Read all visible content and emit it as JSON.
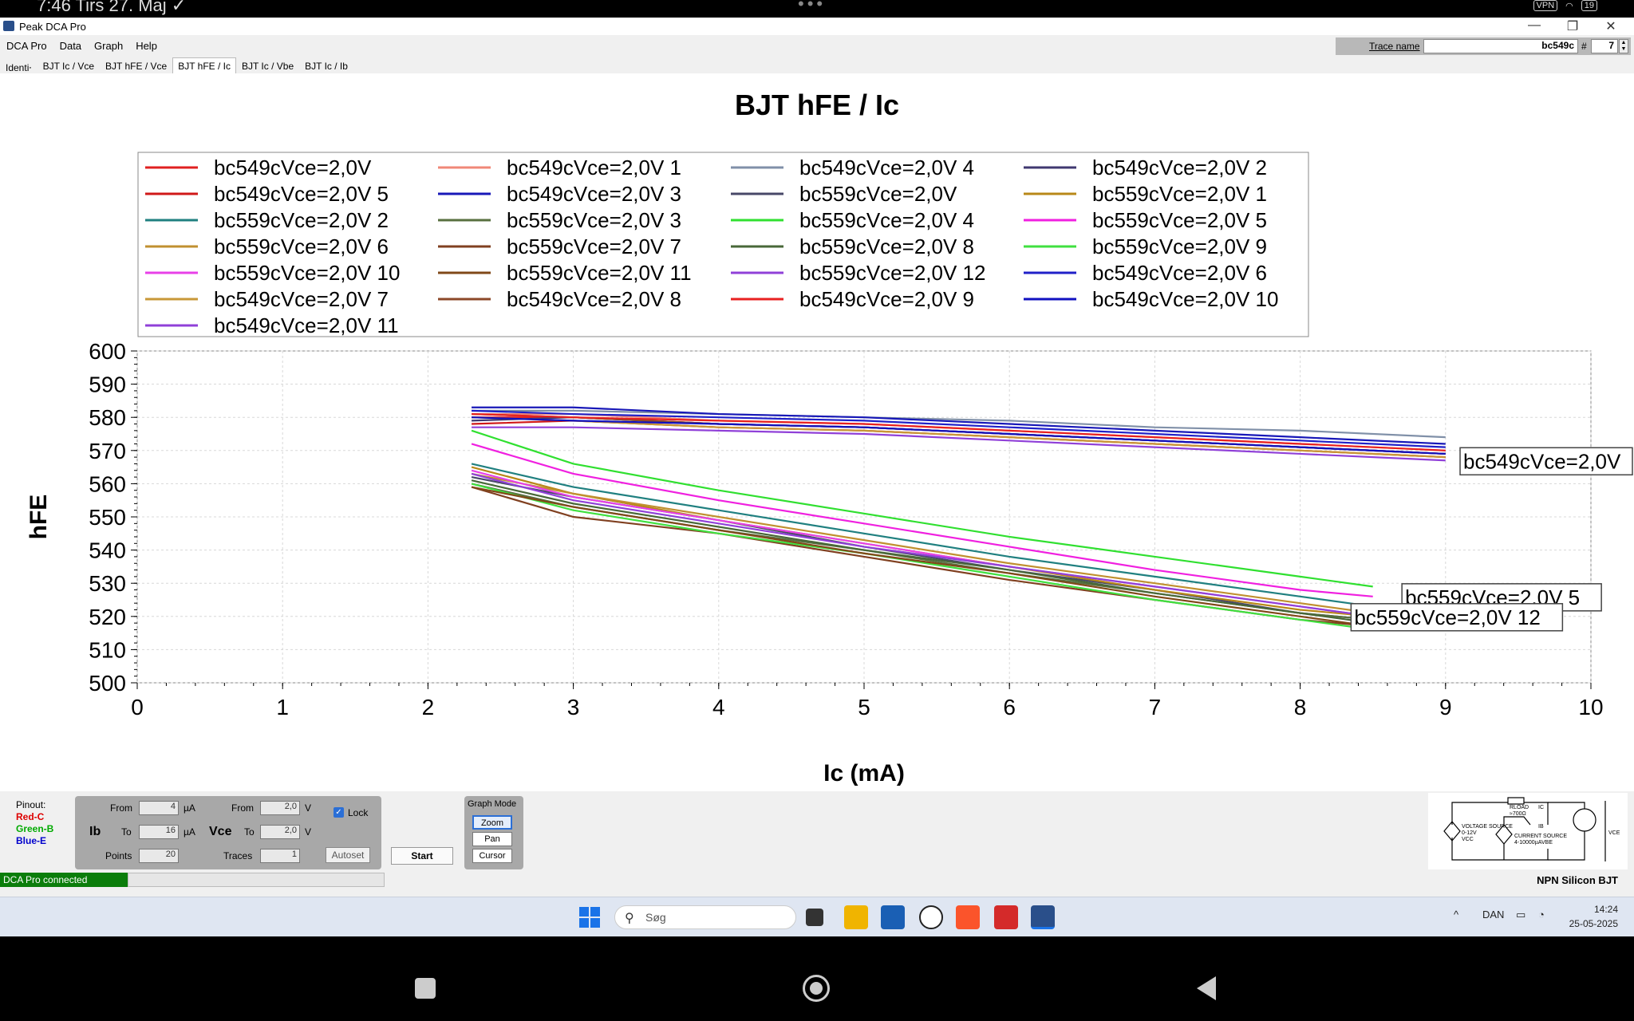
{
  "android": {
    "time": "7:46",
    "date": "Tirs 27. Maj",
    "vpn": "VPN",
    "battery": "19"
  },
  "window": {
    "title": "Peak DCA Pro",
    "minimize": "—",
    "maximize": "❐",
    "close": "✕"
  },
  "menu": [
    "DCA Pro",
    "Data",
    "Graph",
    "Help"
  ],
  "trace": {
    "label": "Trace name",
    "name_value": "bc549c",
    "hash": "#",
    "number_value": "7"
  },
  "tabs": [
    "Identi⸱",
    "BJT Ic / Vce",
    "BJT hFE / Vce",
    "BJT hFE / Ic",
    "BJT Ic / Vbe",
    "BJT Ic / Ib"
  ],
  "active_tab": 3,
  "chart_data": {
    "type": "line",
    "title": "BJT hFE / Ic",
    "xlabel": "Ic (mA)",
    "ylabel": "hFE",
    "xlim": [
      0,
      10
    ],
    "ylim": [
      500,
      600
    ],
    "xticks": [
      0,
      1,
      2,
      3,
      4,
      5,
      6,
      7,
      8,
      9,
      10
    ],
    "yticks": [
      500,
      510,
      520,
      530,
      540,
      550,
      560,
      570,
      580,
      590,
      600
    ],
    "grid": true,
    "legend_position": "top",
    "series": [
      {
        "name": "bc549cVce=2,0V",
        "color": "#e02020",
        "x": [
          2.3,
          3,
          4,
          5,
          6,
          7,
          8,
          9
        ],
        "y": [
          580,
          580,
          578,
          577,
          575,
          573,
          571,
          569
        ]
      },
      {
        "name": "bc549cVce=2,0V 1",
        "color": "#f08878",
        "x": [
          2.3,
          3,
          4,
          5,
          6,
          7,
          8,
          9
        ],
        "y": [
          581,
          581,
          579,
          578,
          576,
          574,
          572,
          570
        ]
      },
      {
        "name": "bc549cVce=2,0V 4",
        "color": "#8090a8",
        "x": [
          2.3,
          3,
          4,
          5,
          6,
          7,
          8,
          9
        ],
        "y": [
          582,
          582,
          581,
          580,
          579,
          577,
          576,
          574
        ]
      },
      {
        "name": "bc549cVce=2,0V 2",
        "color": "#403870",
        "x": [
          2.3,
          3,
          4,
          5,
          6,
          7,
          8,
          9
        ],
        "y": [
          579,
          580,
          578,
          577,
          575,
          573,
          571,
          569
        ]
      },
      {
        "name": "bc549cVce=2,0V 5",
        "color": "#d01818",
        "x": [
          2.3,
          3,
          4,
          5,
          6,
          7,
          8,
          9
        ],
        "y": [
          578,
          579,
          577,
          576,
          574,
          572,
          570,
          568
        ]
      },
      {
        "name": "bc549cVce=2,0V 3",
        "color": "#1818b8",
        "x": [
          2.3,
          3,
          4,
          5,
          6,
          7,
          8,
          9
        ],
        "y": [
          583,
          583,
          581,
          580,
          578,
          576,
          574,
          572
        ]
      },
      {
        "name": "bc559cVce=2,0V",
        "color": "#484868",
        "x": [
          2.3,
          3,
          4,
          5,
          6,
          7,
          8,
          8.5
        ],
        "y": [
          562,
          556,
          549,
          541,
          534,
          528,
          521,
          519
        ]
      },
      {
        "name": "bc559cVce=2,0V 1",
        "color": "#b88818",
        "x": [
          2.3,
          3,
          4,
          5,
          6,
          7,
          8,
          8.5
        ],
        "y": [
          565,
          557,
          549,
          542,
          535,
          528,
          522,
          520
        ]
      },
      {
        "name": "bc559cVce=2,0V 2",
        "color": "#208080",
        "x": [
          2.3,
          3,
          4,
          5,
          6,
          7,
          8,
          8.5
        ],
        "y": [
          566,
          559,
          552,
          545,
          538,
          532,
          526,
          523
        ]
      },
      {
        "name": "bc559cVce=2,0V 3",
        "color": "#587040",
        "x": [
          2.3,
          3,
          4,
          5,
          6,
          7,
          8,
          8.5
        ],
        "y": [
          560,
          553,
          546,
          540,
          533,
          527,
          521,
          519
        ]
      },
      {
        "name": "bc559cVce=2,0V 4",
        "color": "#30e030",
        "x": [
          2.3,
          3,
          4,
          5,
          6,
          7,
          8,
          8.5
        ],
        "y": [
          576,
          566,
          558,
          551,
          544,
          538,
          532,
          529
        ]
      },
      {
        "name": "bc559cVce=2,0V 5",
        "color": "#f020e0",
        "x": [
          2.3,
          3,
          4,
          5,
          6,
          7,
          8,
          8.5
        ],
        "y": [
          572,
          563,
          555,
          548,
          541,
          534,
          528,
          526
        ]
      },
      {
        "name": "bc559cVce=2,0V 6",
        "color": "#c09030",
        "x": [
          2.3,
          3,
          4,
          5,
          6,
          7,
          8,
          8.5
        ],
        "y": [
          563,
          557,
          550,
          543,
          536,
          530,
          524,
          521
        ]
      },
      {
        "name": "bc559cVce=2,0V 7",
        "color": "#804020",
        "x": [
          2.3,
          3,
          4,
          5,
          6,
          7,
          8,
          8.5
        ],
        "y": [
          559,
          550,
          545,
          538,
          531,
          525,
          519,
          517
        ]
      },
      {
        "name": "bc559cVce=2,0V 8",
        "color": "#486838",
        "x": [
          2.3,
          3,
          4,
          5,
          6,
          7,
          8,
          8.5
        ],
        "y": [
          561,
          554,
          547,
          540,
          534,
          527,
          521,
          518
        ]
      },
      {
        "name": "bc559cVce=2,0V 9",
        "color": "#40e040",
        "x": [
          2.3,
          3,
          4,
          5,
          6,
          7,
          8,
          8.5
        ],
        "y": [
          560,
          552,
          545,
          539,
          532,
          525,
          519,
          516
        ]
      },
      {
        "name": "bc559cVce=2,0V 10",
        "color": "#e840e8",
        "x": [
          2.3,
          3,
          4,
          5,
          6,
          7,
          8,
          8.5
        ],
        "y": [
          564,
          556,
          549,
          542,
          535,
          529,
          523,
          520
        ]
      },
      {
        "name": "bc559cVce=2,0V 11",
        "color": "#804818",
        "x": [
          2.3,
          3,
          4,
          5,
          6,
          7,
          8,
          8.5
        ],
        "y": [
          559,
          553,
          546,
          539,
          533,
          526,
          520,
          517
        ]
      },
      {
        "name": "bc559cVce=2,0V 12",
        "color": "#9040d8",
        "x": [
          2.3,
          3,
          4,
          5,
          6,
          7,
          8,
          8.5
        ],
        "y": [
          563,
          555,
          548,
          541,
          535,
          529,
          523,
          520
        ]
      },
      {
        "name": "bc549cVce=2,0V 6",
        "color": "#2020c8",
        "x": [
          2.3,
          3,
          4,
          5,
          6,
          7,
          8,
          9
        ],
        "y": [
          582,
          581,
          580,
          579,
          577,
          575,
          573,
          571
        ]
      },
      {
        "name": "bc549cVce=2,0V 7",
        "color": "#c89838",
        "x": [
          2.3,
          3,
          4,
          5,
          6,
          7,
          8,
          9
        ],
        "y": [
          580,
          579,
          577,
          576,
          574,
          572,
          570,
          568
        ]
      },
      {
        "name": "bc549cVce=2,0V 8",
        "color": "#8c4828",
        "x": [
          2.3,
          3,
          4,
          5,
          6,
          7,
          8,
          9
        ],
        "y": [
          581,
          580,
          578,
          577,
          575,
          573,
          571,
          569
        ]
      },
      {
        "name": "bc549cVce=2,0V 9",
        "color": "#e82020",
        "x": [
          2.3,
          3,
          4,
          5,
          6,
          7,
          8,
          9
        ],
        "y": [
          581,
          580,
          579,
          578,
          576,
          574,
          572,
          570
        ]
      },
      {
        "name": "bc549cVce=2,0V 10",
        "color": "#1010c0",
        "x": [
          2.3,
          3,
          4,
          5,
          6,
          7,
          8,
          9
        ],
        "y": [
          580,
          579,
          578,
          577,
          575,
          573,
          571,
          569
        ]
      },
      {
        "name": "bc549cVce=2,0V 11",
        "color": "#9040d8",
        "x": [
          2.3,
          3,
          4,
          5,
          6,
          7,
          8,
          9
        ],
        "y": [
          577,
          577,
          576,
          575,
          573,
          571,
          569,
          567
        ]
      }
    ],
    "callouts": [
      {
        "text": "bc549cVce=2,0V",
        "at_x": 9.1,
        "at_y": 567
      },
      {
        "text": "bc559cVce=2,0V 5",
        "at_x": 8.7,
        "at_y": 526
      },
      {
        "text": "bc559cVce=2,0V 12",
        "at_x": 8.35,
        "at_y": 520
      }
    ]
  },
  "controls": {
    "pinout_label": "Pinout:",
    "pin_c": "Red-C",
    "pin_b": "Green-B",
    "pin_e": "Blue-E",
    "ib_label": "Ib",
    "vce_label": "Vce",
    "from_label": "From",
    "to_label": "To",
    "points_label": "Points",
    "traces_label": "Traces",
    "ib_from": "4",
    "ib_to": "16",
    "ib_unit": "µA",
    "vce_from": "2,0",
    "vce_to": "2,0",
    "vce_unit": "V",
    "points": "20",
    "traces": "1",
    "lock_label": "Lock",
    "lock_checked": true,
    "autoset_label": "Autoset",
    "start_label": "Start",
    "graph_mode_label": "Graph Mode",
    "modes": [
      "Zoom",
      "Pan",
      "Cursor"
    ],
    "active_mode": "Zoom"
  },
  "circuit": {
    "rload": "RLOAD",
    "rload_value": "≈700Ω",
    "ic": "IC",
    "ib": "IB",
    "vce": "VCE",
    "vbe": "VBE",
    "voltage_source": "VOLTAGE SOURCE",
    "voltage_range": "0-12V",
    "vcc": "VCC",
    "current_source": "CURRENT SOURCE",
    "current_range": "4-10000µA"
  },
  "status": {
    "connection": "DCA Pro connected",
    "device_type": "NPN Silicon BJT"
  },
  "taskbar": {
    "search_placeholder": "Søg",
    "language": "DAN",
    "time": "14:24",
    "date": "25-05-2025"
  }
}
